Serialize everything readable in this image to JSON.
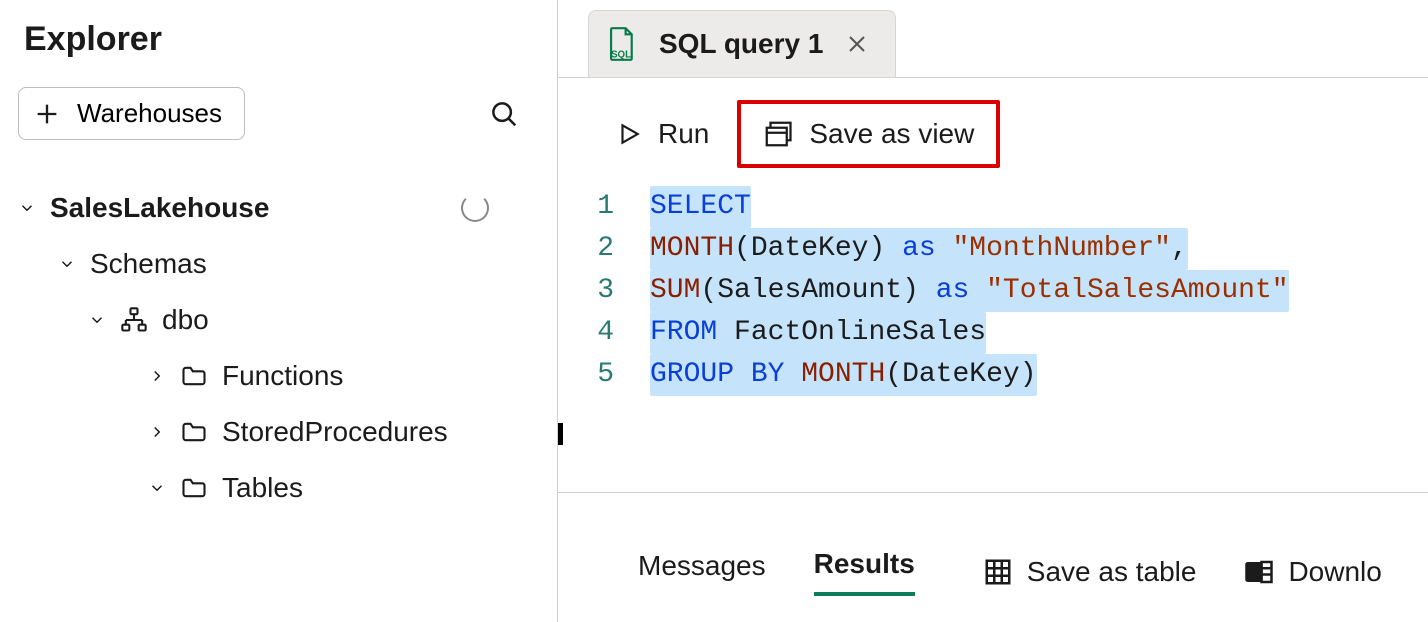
{
  "explorer": {
    "title": "Explorer",
    "add_button": "Warehouses",
    "tree": {
      "warehouse": "SalesLakehouse",
      "schemas_label": "Schemas",
      "schema_name": "dbo",
      "folders": {
        "functions": "Functions",
        "procs": "StoredProcedures",
        "tables": "Tables"
      }
    }
  },
  "tab": {
    "label": "SQL query 1"
  },
  "toolbar": {
    "run": "Run",
    "save_view": "Save as view"
  },
  "code": {
    "line_numbers": [
      "1",
      "2",
      "3",
      "4",
      "5"
    ],
    "l1_select": "SELECT",
    "l2_func": "MONTH",
    "l2_open": "(",
    "l2_arg": "DateKey",
    "l2_close": ")",
    "l2_as": "as",
    "l2_str": "\"MonthNumber\"",
    "l2_comma": ",",
    "l3_func": "SUM",
    "l3_open": "(",
    "l3_arg": "SalesAmount",
    "l3_close": ")",
    "l3_as": "as",
    "l3_str": "\"TotalSalesAmount\"",
    "l4_from": "FROM",
    "l4_table": "FactOnlineSales",
    "l5_group": "GROUP",
    "l5_by": "BY",
    "l5_func": "MONTH",
    "l5_open": "(",
    "l5_arg": "DateKey",
    "l5_close": ")"
  },
  "results": {
    "messages": "Messages",
    "results": "Results",
    "save_table": "Save as table",
    "download": "Downlo"
  }
}
